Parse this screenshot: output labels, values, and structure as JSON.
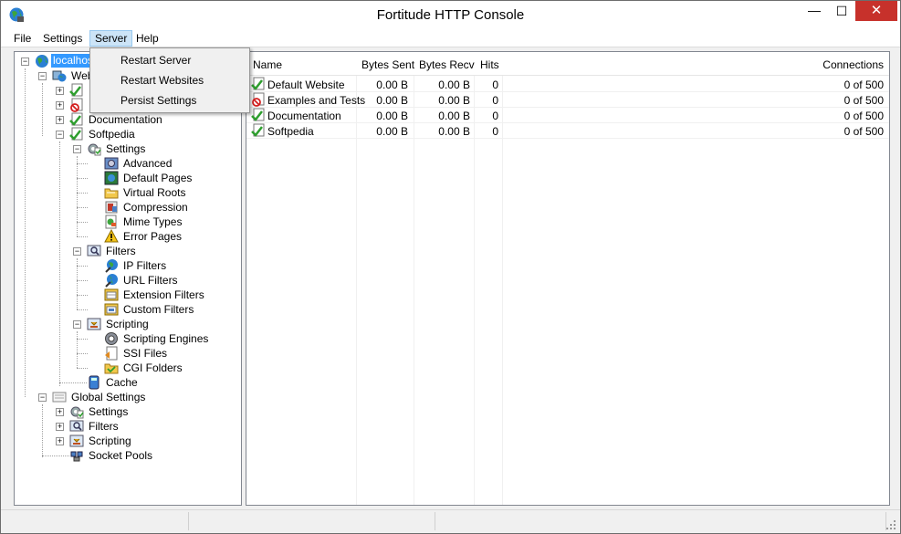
{
  "window": {
    "title": "Fortitude HTTP Console"
  },
  "menu": {
    "file": "File",
    "settings": "Settings",
    "server": "Server",
    "help": "Help"
  },
  "server_menu": {
    "items": [
      "Restart Server",
      "Restart Websites",
      "Persist Settings"
    ]
  },
  "tree": {
    "root": "localhost",
    "websites": "Websites",
    "documentation": "Documentation",
    "softpedia": "Softpedia",
    "settings": "Settings",
    "advanced": "Advanced",
    "default_pages": "Default Pages",
    "virtual_roots": "Virtual Roots",
    "compression": "Compression",
    "mime_types": "Mime Types",
    "error_pages": "Error Pages",
    "filters": "Filters",
    "ip_filters": "IP Filters",
    "url_filters": "URL Filters",
    "extension_filters": "Extension Filters",
    "custom_filters": "Custom Filters",
    "scripting": "Scripting",
    "scripting_engines": "Scripting Engines",
    "ssi_files": "SSI Files",
    "cgi_folders": "CGI Folders",
    "cache": "Cache",
    "global_settings": "Global Settings",
    "g_settings": "Settings",
    "g_filters": "Filters",
    "g_scripting": "Scripting",
    "socket_pools": "Socket Pools"
  },
  "list": {
    "columns": {
      "name": "Name",
      "bytes_sent": "Bytes Sent",
      "bytes_recv": "Bytes Recv",
      "hits": "Hits",
      "connections": "Connections"
    },
    "rows": [
      {
        "name": "Default Website",
        "status": "running",
        "bytes_sent": "0.00 B",
        "bytes_recv": "0.00 B",
        "hits": "0",
        "connections": "0 of 500"
      },
      {
        "name": "Examples and Tests",
        "status": "stopped",
        "bytes_sent": "0.00 B",
        "bytes_recv": "0.00 B",
        "hits": "0",
        "connections": "0 of 500"
      },
      {
        "name": "Documentation",
        "status": "running",
        "bytes_sent": "0.00 B",
        "bytes_recv": "0.00 B",
        "hits": "0",
        "connections": "0 of 500"
      },
      {
        "name": "Softpedia",
        "status": "running",
        "bytes_sent": "0.00 B",
        "bytes_recv": "0.00 B",
        "hits": "0",
        "connections": "0 of 500"
      }
    ]
  },
  "colors": {
    "selection": "#3399ff",
    "close_button": "#c7312b",
    "menu_highlight": "#cce4f7",
    "check_green": "#2e9e2e",
    "stop_red": "#d42020"
  }
}
